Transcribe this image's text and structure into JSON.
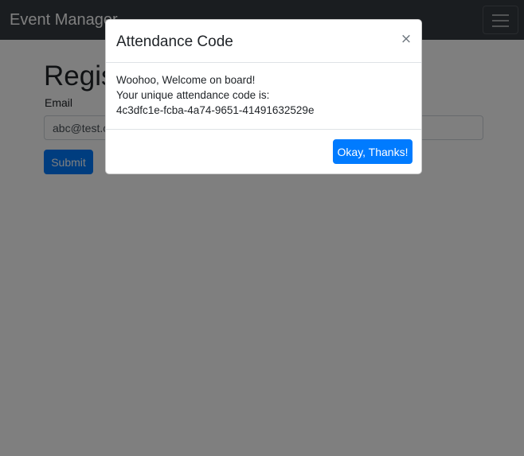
{
  "navbar": {
    "brand": "Event Manager",
    "toggler_icon": "hamburger-icon"
  },
  "form": {
    "heading": "Register",
    "email_label": "Email",
    "email_value": "abc@test.com",
    "submit_label": "Submit"
  },
  "modal": {
    "title": "Attendance Code",
    "close_symbol": "×",
    "close_icon": "close-icon",
    "line1": "Woohoo, Welcome on board!",
    "line2": "Your unique attendance code is:",
    "code": "4c3dfc1e-fcba-4a74-9651-41491632529e",
    "confirm_label": "Okay, Thanks!"
  },
  "colors": {
    "navbar_bg": "#343a40",
    "primary": "#007bff",
    "backdrop": "rgba(0,0,0,0.5)"
  }
}
